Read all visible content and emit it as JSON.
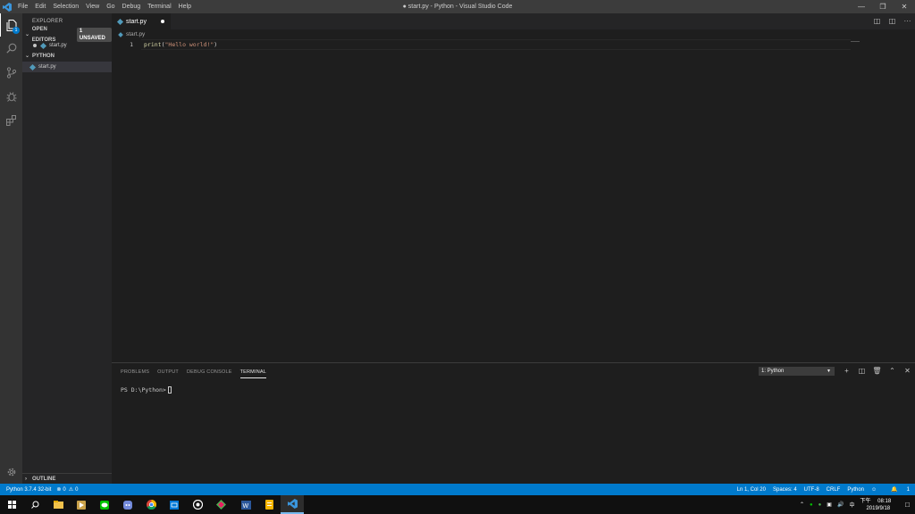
{
  "window": {
    "title": "● start.py - Python - Visual Studio Code",
    "menu": [
      "File",
      "Edit",
      "Selection",
      "View",
      "Go",
      "Debug",
      "Terminal",
      "Help"
    ],
    "controls": [
      "minimize-icon",
      "restore-icon",
      "close-icon"
    ]
  },
  "activity_bar": {
    "items": [
      "files-icon",
      "search-icon",
      "source-control-icon",
      "debug-icon",
      "extensions-icon"
    ],
    "explorer_badge": "1",
    "manage": "gear-icon"
  },
  "sidebar": {
    "title": "EXPLORER",
    "open_editors": {
      "label": "OPEN EDITORS",
      "badge": "1 UNSAVED",
      "files": [
        "start.py"
      ]
    },
    "folder": {
      "label": "PYTHON",
      "files": [
        "start.py"
      ]
    },
    "outline": "OUTLINE"
  },
  "editor": {
    "tab": {
      "label": "start.py",
      "dirty": true
    },
    "breadcrumb": "start.py",
    "lines": [
      {
        "number": "1",
        "fn": "print",
        "open": "(",
        "str": "\"Hello world!\"",
        "close": ")"
      }
    ],
    "actions": [
      "open-changes-icon",
      "split-editor-icon",
      "more-actions-icon"
    ]
  },
  "panel": {
    "tabs": [
      "PROBLEMS",
      "OUTPUT",
      "DEBUG CONSOLE",
      "TERMINAL"
    ],
    "active_tab": "TERMINAL",
    "terminal_select": "1: Python",
    "actions": [
      "plus-icon",
      "split-terminal-icon",
      "trash-icon",
      "chevron-up-icon",
      "close-icon"
    ],
    "prompt": "PS D:\\Python>"
  },
  "status_bar": {
    "interpreter": "Python 3.7.4 32-bit",
    "errors": "0",
    "warnings": "0",
    "position": "Ln 1, Col 20",
    "spaces": "Spaces: 4",
    "encoding": "UTF-8",
    "eol": "CRLF",
    "language": "Python",
    "notifications": "1"
  },
  "taskbar": {
    "apps": [
      "windows-start-icon",
      "search-icon",
      "file-explorer-icon",
      "media-icon",
      "line-icon",
      "discord-icon",
      "chrome-icon",
      "mail-icon",
      "obs-icon",
      "git-icon",
      "word-icon",
      "notes-icon",
      "vscode-icon"
    ],
    "time": "08:18",
    "am_pm": "下午",
    "date": "2019/9/18",
    "ime": "中"
  },
  "colors": {
    "accent": "#007acc",
    "titlebar": "#3c3c3c",
    "sidebar": "#252526",
    "editor": "#1e1e1e",
    "string": "#ce9178",
    "function": "#dcdcaa"
  }
}
